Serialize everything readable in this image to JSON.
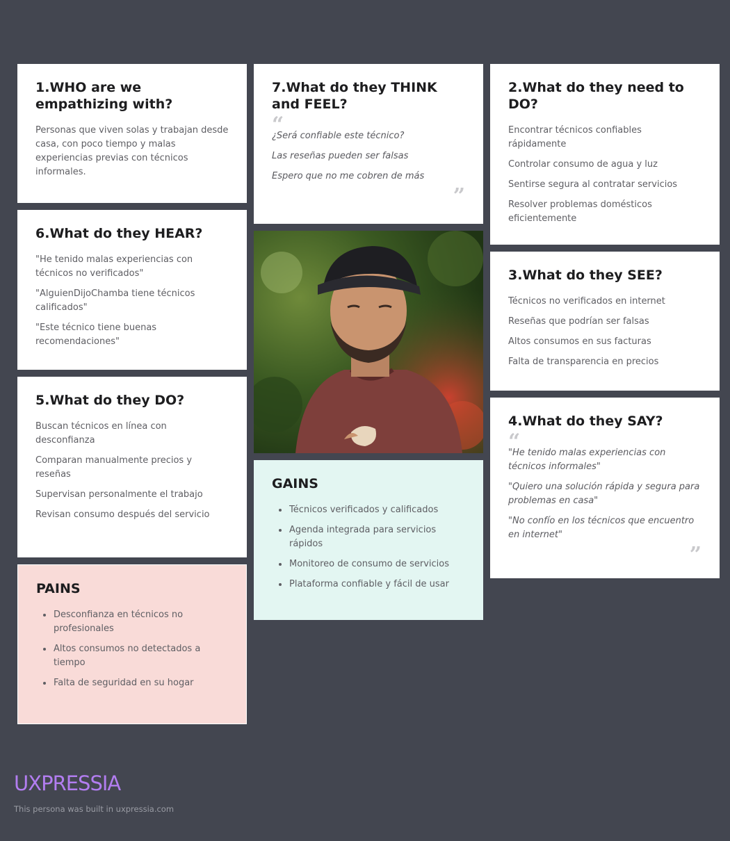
{
  "who": {
    "title": "1.WHO are we empathizing with?",
    "items": [
      "Personas que viven solas y trabajan desde casa, con poco tiempo y malas experiencias previas con técnicos informales."
    ]
  },
  "think": {
    "title": "7.What do they THINK and FEEL?",
    "items": [
      "¿Será confiable este técnico?",
      "Las reseñas pueden ser falsas",
      "Espero que no me cobren de más"
    ]
  },
  "need": {
    "title": "2.What do they need to DO?",
    "items": [
      "Encontrar técnicos confiables rápidamente",
      "Controlar consumo de agua y luz",
      "Sentirse segura al contratar servicios",
      "Resolver problemas domésticos eficientemente"
    ]
  },
  "hear": {
    "title": "6.What do they HEAR?",
    "items": [
      "\"He tenido malas experiencias con técnicos no verificados\"",
      "\"AlguienDijoChamba tiene técnicos calificados\"",
      "\"Este técnico tiene buenas recomendaciones\""
    ]
  },
  "see": {
    "title": "3.What do they SEE?",
    "items": [
      "Técnicos no verificados en internet",
      "Reseñas que podrían ser falsas",
      "Altos consumos en sus facturas",
      "Falta de transparencia en precios"
    ]
  },
  "do": {
    "title": "5.What do they DO?",
    "items": [
      "Buscan técnicos en línea con desconfianza",
      "Comparan manualmente precios y reseñas",
      "Supervisan personalmente el trabajo",
      "Revisan consumo después del servicio"
    ]
  },
  "say": {
    "title": "4.What do they SAY?",
    "items": [
      "\"He tenido malas experiencias con técnicos informales\"",
      "\"Quiero una solución rápida y segura para problemas en casa\"",
      "\"No confío en los técnicos que encuentro en internet\""
    ]
  },
  "gains": {
    "title": "GAINS",
    "items": [
      "Técnicos verificados y calificados",
      "Agenda integrada para servicios rápidos",
      "Monitoreo de consumo de servicios",
      "Plataforma confiable y fácil de usar"
    ]
  },
  "pains": {
    "title": "PAINS",
    "items": [
      "Desconfianza en técnicos no profesionales",
      "Altos consumos no detectados a tiempo",
      "Falta de seguridad en su hogar"
    ]
  },
  "quote_marks": {
    "open": "“",
    "close": "”"
  },
  "footer": {
    "brand": "UXPRESSIA",
    "caption": "This persona was built in uxpressia.com"
  },
  "colors": {
    "background": "#434650",
    "pains_bg": "#f9dbd8",
    "gains_bg": "#e3f6f2",
    "brand": "#b27df0"
  }
}
